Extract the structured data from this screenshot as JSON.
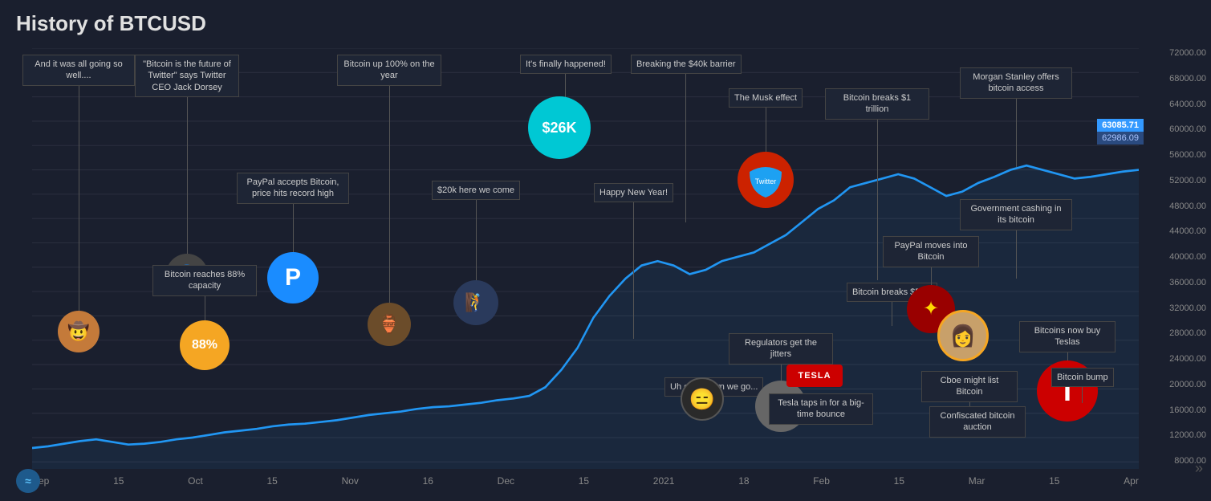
{
  "title": "History of BTCUSD",
  "yAxis": {
    "labels": [
      "72000.00",
      "68000.00",
      "64000.00",
      "60000.00",
      "56000.00",
      "52000.00",
      "48000.00",
      "44000.00",
      "40000.00",
      "36000.00",
      "32000.00",
      "28000.00",
      "24000.00",
      "20000.00",
      "16000.00",
      "12000.00",
      "8000.00"
    ]
  },
  "xAxis": {
    "labels": [
      "Sep",
      "15",
      "Oct",
      "15",
      "Nov",
      "16",
      "Dec",
      "15",
      "2021",
      "18",
      "Feb",
      "15",
      "Mar",
      "15",
      "Apr"
    ]
  },
  "prices": {
    "current": "63085.71",
    "prev": "62986.09"
  },
  "annotations": [
    {
      "id": "ann1",
      "label": "And it was all going so well....",
      "hasCircle": true,
      "circleColor": "#c47a3a",
      "circleContent": "😄"
    },
    {
      "id": "ann2",
      "label": "\"Bitcoin is the future of Twitter\" says Twitter CEO Jack Dorsey",
      "hasCircle": true,
      "circleColor": "#444",
      "circleContent": "👤"
    },
    {
      "id": "ann3",
      "label": "Bitcoin reaches 88% capacity",
      "hasCircle": true,
      "circleColor": "#f5a623",
      "circleContent": "88%"
    },
    {
      "id": "ann4",
      "label": "PayPal accepts Bitcoin, price hits record high",
      "hasCircle": true,
      "circleColor": "#1a8cff",
      "circleContent": "P"
    },
    {
      "id": "ann5",
      "label": "Bitcoin up 100% on the year",
      "hasCircle": true,
      "circleColor": "#6b4c2a",
      "circleContent": "🏺"
    },
    {
      "id": "ann6",
      "label": "$20k here we come",
      "hasCircle": true,
      "circleColor": "#3a5a7c",
      "circleContent": "🧗"
    },
    {
      "id": "ann7",
      "label": "It's finally happened!",
      "hasCircle": false,
      "circleContent": ""
    },
    {
      "id": "ann8",
      "label": "$26K",
      "hasCircle": true,
      "circleColor": "#00c8d4",
      "circleContent": "$26K"
    },
    {
      "id": "ann9",
      "label": "Breaking the $40k barrier",
      "hasCircle": false
    },
    {
      "id": "ann10",
      "label": "Happy New Year!",
      "hasCircle": false
    },
    {
      "id": "ann11",
      "label": "Uh oh... down we go...",
      "hasCircle": true,
      "circleColor": "#2a2a2a",
      "circleContent": "😑"
    },
    {
      "id": "ann12",
      "label": "The Musk effect",
      "hasCircle": true,
      "circleColor": "#cc2200",
      "circleContent": "Twitter"
    },
    {
      "id": "ann13",
      "label": "Regulators get the jitters",
      "hasCircle": true,
      "circleColor": "#555",
      "circleContent": "👩"
    },
    {
      "id": "ann14",
      "label": "Tesla taps in for a big-time bounce",
      "hasCircle": true,
      "circleColor": "#cc0000",
      "circleContent": "TESLA"
    },
    {
      "id": "ann15",
      "label": "Bitcoin breaks $1 trillion",
      "hasCircle": false
    },
    {
      "id": "ann16",
      "label": "Bitcoin breaks $50k!",
      "hasCircle": false
    },
    {
      "id": "ann17",
      "label": "PayPal moves into Bitcoin",
      "hasCircle": true,
      "circleColor": "#990000",
      "circleContent": "✦"
    },
    {
      "id": "ann18",
      "label": "Cboe might list Bitcoin",
      "hasCircle": false
    },
    {
      "id": "ann19",
      "label": "Confiscated bitcoin auction",
      "hasCircle": false
    },
    {
      "id": "ann20",
      "label": "Morgan Stanley offers bitcoin access",
      "hasCircle": false
    },
    {
      "id": "ann21",
      "label": "Government cashing in its bitcoin",
      "hasCircle": false
    },
    {
      "id": "ann22",
      "label": "Bitcoins now buy Teslas",
      "hasCircle": true,
      "circleColor": "#cc0000",
      "circleContent": "T"
    },
    {
      "id": "ann23",
      "label": "Bitcoin bump",
      "hasCircle": false
    }
  ],
  "navArrow": "»",
  "logoIcon": "≈"
}
